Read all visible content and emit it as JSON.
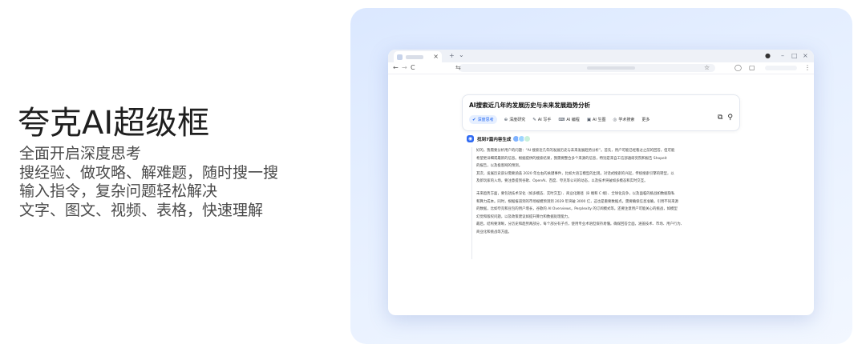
{
  "hero": {
    "title": "夸克AI超级框",
    "lines": [
      "全面开启深度思考",
      "搜经验、做攻略、解难题，随时搜一搜",
      "输入指令，复杂问题轻松解决",
      "文字、图文、视频、表格，快速理解"
    ]
  },
  "browser": {
    "tab_close": "×",
    "new_tab": "+",
    "tab_menu": "⌄",
    "window_controls": [
      "–",
      "□",
      "×"
    ],
    "nav": [
      "←",
      "→",
      "C"
    ],
    "addr_icon": "⇆",
    "toolbar_icons": [
      "star-icon",
      "chat-icon",
      "panels-icon",
      "extensions-icon",
      "menu-icon"
    ],
    "star": "☆",
    "menu": "⋮"
  },
  "search": {
    "query": "AI搜索近几年的发展历史与未来发展趋势分析",
    "modes": [
      {
        "label": "深度思考",
        "icon": "✔",
        "active": true
      },
      {
        "label": "深度研究",
        "icon": "⊕"
      },
      {
        "label": "AI 写手",
        "icon": "✎"
      },
      {
        "label": "AI 编程",
        "icon": "⌨"
      },
      {
        "label": "AI 生图",
        "icon": "▣"
      },
      {
        "label": "学术搜索",
        "icon": "◎"
      },
      {
        "label": "更多",
        "icon": ""
      }
    ],
    "right_icons": [
      "image-icon",
      "search-icon"
    ],
    "image_glyph": "⧉",
    "search_glyph": "⚲"
  },
  "result": {
    "icon_glyph": "◉",
    "title": "找到7篇内容生成",
    "source_colors": [
      "#7fb2ff",
      "#9fd5ff",
      "#c8f0da"
    ],
    "paragraphs": [
      [
        "好的，我需要分析用户的问题：“AI 搜索近几年的发展历史与未来发展趋势分析”。首先，用户可能已经看过之前的回答，但可能",
        "希望更详细或最新的信息。根据提供的搜索结果，我需要整合多个来源的信息，特别是来自工信部通研究院和报告 Shopeit",
        "的报告，以及极客网的预测。",
        "其次，发展历史部分需要涵盖 2020 年左右的关键事件，比如大语言模型的出现，对话式搜索的兴起，传统搜索引擎的转型，以",
        "及新玩家的入场，要注意提到谷歌、OpenAI、百度、夸克等公司的动态，以及技术突破如多模态和实时交互。"
      ],
      [
        "未来趋势方面，要包括技术深化（如多模态、实时交互）、商业化路径（B 端和 C 端）、全球化竞争，以及面临的挑战如数据隐私",
        "和算力成本。同时，根据报道到的市场规模预测到 2029 年突破 3000 亿，这也是重要数据点。需要确保信息准确，引用不同来源",
        "的数据，比如夸克和豆包的用户增长，谷歌的 AI Overviews，Perplexity 的订阅模式等。还要注意用户可能关心的挑战，如模型",
        "幻觉和版权问题，以及政策建议如提升算力和数据处理能力。",
        "最后，结构要清晰，分历史和趋势两部分，每个部分有子点，使用专业术语但保持易懂。确保回答全面，涵盖技术、市场、用户行为、",
        "商业化和挑战等方面。"
      ]
    ]
  }
}
